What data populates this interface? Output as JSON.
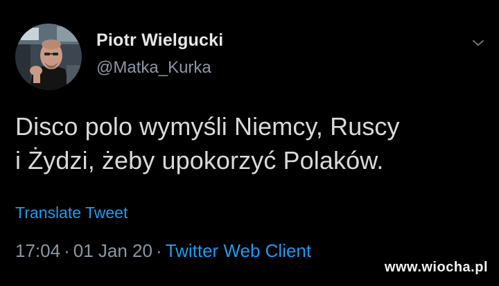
{
  "tweet": {
    "author": {
      "display_name": "Piotr Wielgucki",
      "handle": "@Matka_Kurka",
      "avatar_icon": "user-avatar-photo"
    },
    "menu_icon": "chevron-down-icon",
    "text_lines": [
      "Disco polo wymyśli Niemcy, Ruscy",
      "i Żydzi, żeby upokorzyć Polaków."
    ],
    "translate_label": "Translate Tweet",
    "time": "17:04",
    "date": "01 Jan 20",
    "separator": "·",
    "source": "Twitter Web Client"
  },
  "watermark": "www.wiocha.pl",
  "colors": {
    "background": "#000000",
    "link": "#1d9bf0",
    "muted": "#8b98a5",
    "text": "#d9d9d9"
  }
}
